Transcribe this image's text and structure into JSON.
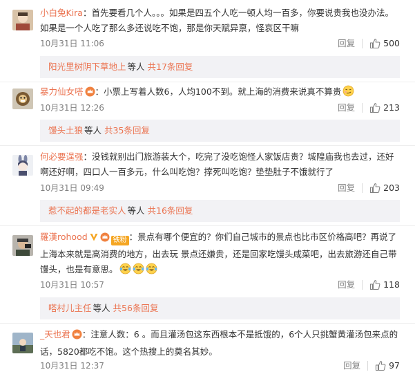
{
  "comments": [
    {
      "user": "小白兔Kira",
      "text": "：首先要看几个人。。。如果是四五个人吃一顿人均一百多，你要说贵我也没办法。如果是一个人吃了那么多还说吃不饱，那是你天赋异禀，怪哀区干嘛",
      "time": "10月31日 11:06",
      "reply_label": "回复",
      "likes": "500",
      "sub_user": "阳光里树阴下草地上",
      "sub_etc": "等人",
      "sub_total": "共17条回复"
    },
    {
      "user": "暴力仙女嗒",
      "text": "：小票上写着人数6，人均100不到。就上海的消费来说真不算贵",
      "time": "10月31日 12:26",
      "reply_label": "回复",
      "likes": "213",
      "sub_user": "馒头土狼",
      "sub_etc": "等人",
      "sub_total": "共35条回复"
    },
    {
      "user": "何必要逞强",
      "text": "：没钱就别出门旅游装大个，吃完了没吃饱怪人家饭店贵？城隍庙我也去过，还好啊还好啊，四口人一百多元，什么叫吃饱？撑死叫吃饱？垫垫肚子不饿就行了",
      "time": "10月31日 09:49",
      "reply_label": "回复",
      "likes": "203",
      "sub_user": "惹不起的都是老实人",
      "sub_etc": "等人",
      "sub_total": "共16条回复"
    },
    {
      "user": "羅漢rohood",
      "fan_badge": "铁粉",
      "text": "：景点有哪个便宜的？你们自己城市的景点也比市区价格高吧？再说了上海本来就是高消费的地方，出去玩 景点还嫌贵，还是回家吃馒头咸菜吧，出去旅游还自己带馒头，也是有意思。",
      "time": "10月31日 10:57",
      "reply_label": "回复",
      "likes": "118",
      "sub_user": "嗒村儿主任",
      "sub_etc": "等人",
      "sub_total": "共56条回复"
    },
    {
      "user": "_天也君",
      "text": "：注意人数：6 。而且灌汤包这东西根本不是抵饿的，6个人只挑蟹黄灌汤包来点的话，5820都吃不饱。这个热搜上的莫名其妙。",
      "time": "10月31日 12:37",
      "reply_label": "回复",
      "likes": "97"
    }
  ],
  "colors": {
    "username": "#eb7350",
    "gold_v": "#f5a623",
    "sub_bg": "#f2f2f5",
    "meta": "#808080"
  },
  "icons": {
    "like": "thumbs-up-icon",
    "vip": "vip-crown-badge",
    "verified": "gold-v-icon",
    "emoji_smirk": "smirk-emoji",
    "emoji_cry_laugh": "laughing-tears-emoji"
  }
}
